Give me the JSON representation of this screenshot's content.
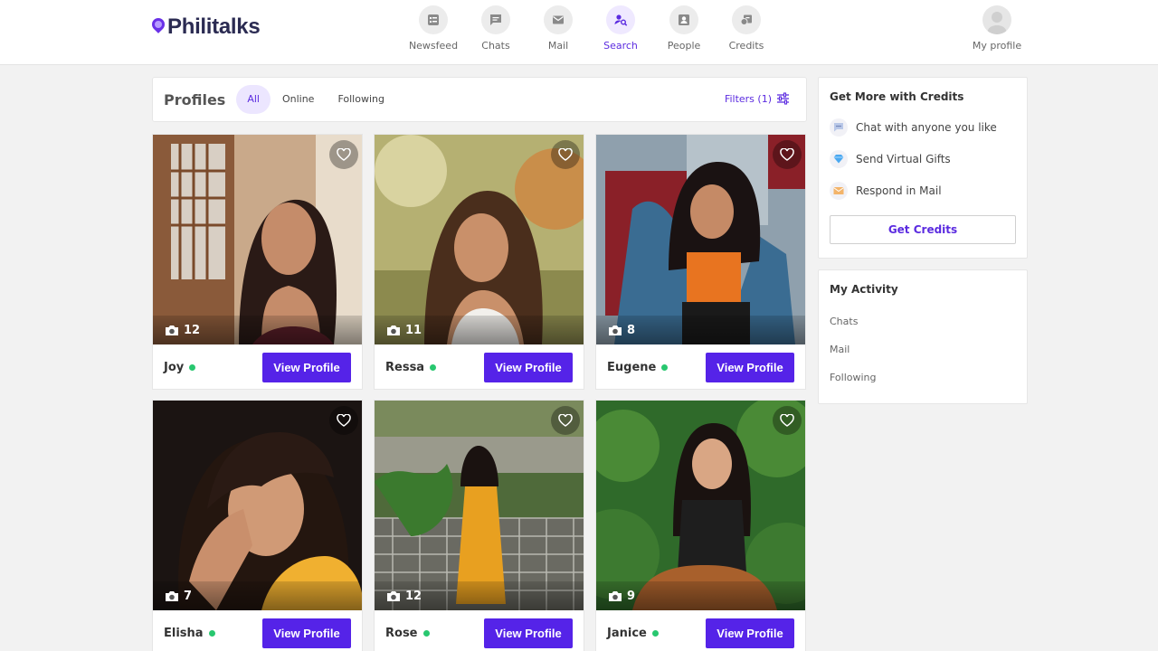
{
  "brand": {
    "name": "Philitalks"
  },
  "nav": [
    {
      "label": "Newsfeed",
      "icon": "newsfeed-icon"
    },
    {
      "label": "Chats",
      "icon": "chat-icon"
    },
    {
      "label": "Mail",
      "icon": "mail-icon"
    },
    {
      "label": "Search",
      "icon": "search-user-icon",
      "active": true
    },
    {
      "label": "People",
      "icon": "people-icon"
    },
    {
      "label": "Credits",
      "icon": "credits-icon"
    }
  ],
  "my_profile": {
    "label": "My profile"
  },
  "profiles": {
    "title": "Profiles",
    "tabs": [
      {
        "label": "All",
        "active": true
      },
      {
        "label": "Online"
      },
      {
        "label": "Following"
      }
    ],
    "filters_label": "Filters (1)"
  },
  "cards": [
    {
      "name": "Joy",
      "photos": "12",
      "online": true,
      "button": "View Profile"
    },
    {
      "name": "Ressa",
      "photos": "11",
      "online": true,
      "button": "View Profile"
    },
    {
      "name": "Eugene",
      "photos": "8",
      "online": true,
      "button": "View Profile"
    },
    {
      "name": "Elisha",
      "photos": "7",
      "online": true,
      "button": "View Profile"
    },
    {
      "name": "Rose",
      "photos": "12",
      "online": true,
      "button": "View Profile"
    },
    {
      "name": "Janice",
      "photos": "9",
      "online": true,
      "button": "View Profile"
    }
  ],
  "credits_panel": {
    "title": "Get More with Credits",
    "items": [
      {
        "label": "Chat with anyone you like",
        "icon": "chat-bubble-icon"
      },
      {
        "label": "Send Virtual Gifts",
        "icon": "diamond-icon"
      },
      {
        "label": "Respond in Mail",
        "icon": "envelope-icon"
      }
    ],
    "button": "Get Credits"
  },
  "activity_panel": {
    "title": "My Activity",
    "items": [
      "Chats",
      "Mail",
      "Following"
    ]
  },
  "colors": {
    "accent": "#5523e8",
    "online": "#28c76f",
    "brand_text": "#2b2b52"
  }
}
